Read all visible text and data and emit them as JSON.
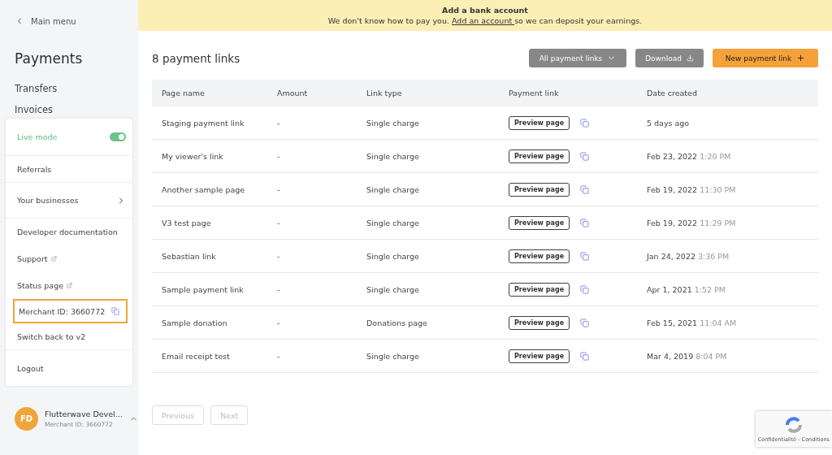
{
  "sidebar": {
    "back_link": "Main menu",
    "title": "Payments",
    "nav_items": [
      "Transfers",
      "Invoices"
    ]
  },
  "account_menu": {
    "items": [
      {
        "kind": "toggle",
        "label": "Live mode",
        "on": true,
        "focused": false
      },
      {
        "kind": "link",
        "label": "Referrals",
        "focused": false
      },
      {
        "kind": "submenu",
        "label": "Your businesses",
        "focused": false
      },
      {
        "kind": "link",
        "label": "Developer documentation",
        "focused": false
      },
      {
        "kind": "external",
        "label": "Support",
        "focused": false
      },
      {
        "kind": "external",
        "label": "Status page",
        "focused": false
      },
      {
        "kind": "copy",
        "label": "Merchant ID: 3660772",
        "focused": true
      },
      {
        "kind": "link",
        "label": "Switch back to v2",
        "focused": false
      },
      {
        "kind": "link",
        "label": "Logout",
        "focused": false
      }
    ]
  },
  "profile": {
    "initials": "FD",
    "name": "Flutterwave Devel...",
    "merchant_id": "Merchant ID: 3660772",
    "expanded": true
  },
  "banner": {
    "title": "Add a bank account",
    "text_before": "We don't know how to pay you.",
    "link": "Add an account ",
    "text_after": "so we can deposit your earnings."
  },
  "header": {
    "title": "8 payment links",
    "filter": "All payment links",
    "download": "Download",
    "new_link": "New payment link"
  },
  "table": {
    "columns": [
      "Page name",
      "Amount",
      "Link type",
      "Payment link",
      "Date created"
    ],
    "rows": [
      {
        "name": "Staging payment link",
        "amount": "-",
        "type": "Single charge",
        "preview": "Preview page",
        "date": "5 days ago"
      },
      {
        "name": "My viewer's link",
        "amount": "-",
        "type": "Single charge",
        "preview": "Preview page",
        "date": "Feb 23, 2022",
        "time": "1:20 PM"
      },
      {
        "name": "Another sample page",
        "amount": "-",
        "type": "Single charge",
        "preview": "Preview page",
        "date": "Feb 19, 2022",
        "time": "11:30 PM"
      },
      {
        "name": "V3 test page",
        "amount": "-",
        "type": "Single charge",
        "preview": "Preview page",
        "date": "Feb 19, 2022",
        "time": "11:29 PM"
      },
      {
        "name": "Sebastian link",
        "amount": "-",
        "type": "Single charge",
        "preview": "Preview page",
        "date": "Jan 24, 2022",
        "time": "3:36 PM"
      },
      {
        "name": "Sample payment link",
        "amount": "-",
        "type": "Single charge",
        "preview": "Preview page",
        "date": "Apr 1, 2021",
        "time": "1:52 PM"
      },
      {
        "name": "Sample donation",
        "amount": "-",
        "type": "Donations page",
        "preview": "Preview page",
        "date": "Feb 15, 2021",
        "time": "11:04 AM"
      },
      {
        "name": "Email receipt test",
        "amount": "-",
        "type": "Single charge",
        "preview": "Preview page",
        "date": "Mar 4, 2019",
        "time": "8:04 PM"
      }
    ]
  },
  "pagination": [
    {
      "label": "Previous",
      "disabled": true
    },
    {
      "label": "Next",
      "disabled": true
    }
  ],
  "captcha": {
    "text": "Confidentialité - Conditions"
  }
}
